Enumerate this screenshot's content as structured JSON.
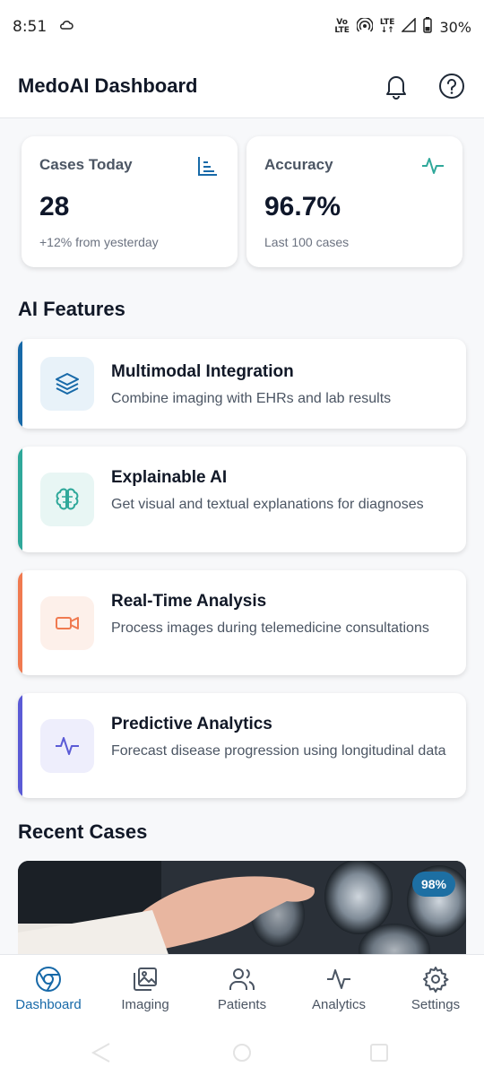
{
  "status": {
    "time": "8:51",
    "net1": "Vo",
    "net1b": "LTE",
    "net2": "LTE",
    "battery": "30%"
  },
  "app": {
    "title": "MedoAI Dashboard"
  },
  "stats": [
    {
      "label": "Cases Today",
      "value": "28",
      "sub": "+12% from yesterday"
    },
    {
      "label": "Accuracy",
      "value": "96.7%",
      "sub": "Last 100 cases"
    }
  ],
  "sections": {
    "features": "AI Features",
    "recent": "Recent Cases"
  },
  "features": [
    {
      "title": "Multimodal Integration",
      "desc": "Combine imaging with EHRs and lab results",
      "icon": "layers-icon",
      "color": "#1769a8"
    },
    {
      "title": "Explainable AI",
      "desc": "Get visual and textual explanations for diagnoses",
      "icon": "brain-icon",
      "color": "#2fa89a"
    },
    {
      "title": "Real-Time Analysis",
      "desc": "Process images during telemedicine consultations",
      "icon": "video-icon",
      "color": "#f07a50"
    },
    {
      "title": "Predictive Analytics",
      "desc": "Forecast disease progression using longitudinal data",
      "icon": "pulse-icon",
      "color": "#5b5bd6"
    }
  ],
  "recent_case": {
    "badge": "98%"
  },
  "nav": [
    {
      "label": "Dashboard",
      "icon": "dashboard-icon",
      "active": true
    },
    {
      "label": "Imaging",
      "icon": "image-icon",
      "active": false
    },
    {
      "label": "Patients",
      "icon": "users-icon",
      "active": false
    },
    {
      "label": "Analytics",
      "icon": "analytics-icon",
      "active": false
    },
    {
      "label": "Settings",
      "icon": "gear-icon",
      "active": false
    }
  ]
}
